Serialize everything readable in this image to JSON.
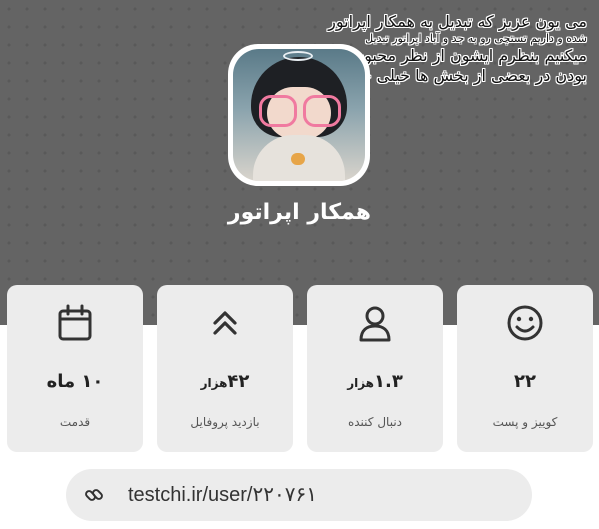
{
  "header": {
    "caption_lines": [
      "می یون عزیز که تبدیل به همکار اپراتور",
      "شده و داریم تستچی رو به جد و آباد اپراتور تبدیل",
      "میکنیم بنظرم ایشون از نظر محبوب",
      "بودن در بعضی از بخش ها خیلی خوبه"
    ],
    "username": "همکار اپراتور",
    "avatar": "avatar-image"
  },
  "stats": [
    {
      "icon": "calendar-icon",
      "value": "۱۰ ماه",
      "unit": "",
      "label": "قدمت"
    },
    {
      "icon": "chevrons-up-icon",
      "value": "۴۲",
      "unit": "هزار",
      "label": "بازدید پروفایل"
    },
    {
      "icon": "user-icon",
      "value": "۱.۳",
      "unit": "هزار",
      "label": "دنبال کننده"
    },
    {
      "icon": "smile-icon",
      "value": "۲۲",
      "unit": "",
      "label": "کوییز و پست"
    }
  ],
  "profile_link": {
    "icon": "link-icon",
    "url": "testchi.ir/user/۲۲۰۷۶۱"
  },
  "colors": {
    "header_bg": "#646464",
    "card_bg": "#ececec",
    "text_dark": "#222222",
    "frame": "#ffffff"
  }
}
